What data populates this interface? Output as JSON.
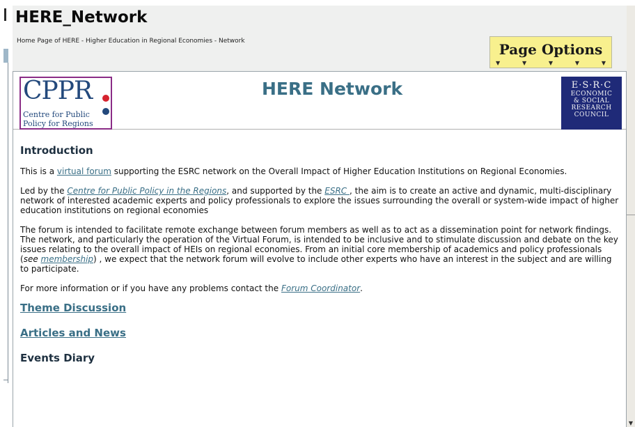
{
  "page": {
    "title": "HERE_Network",
    "breadcrumb": "Home Page of HERE - Higher Education in Regional Economies - Network",
    "page_options_label": "Page Options"
  },
  "banner": {
    "heading": "HERE Network",
    "cppr_logo": {
      "big": "CPPR",
      "line1": "Centre for Public",
      "line2": "Policy for Regions"
    },
    "esrc_logo": {
      "line1": "E·S·R·C",
      "line2": "ECONOMIC",
      "line3": "& SOCIAL",
      "line4": "RESEARCH",
      "line5": "COUNCIL"
    }
  },
  "intro": {
    "heading": "Introduction",
    "p1": {
      "pre": "This is a ",
      "link": "virtual forum",
      "post": " supporting the ESRC network on the Overall Impact of Higher Education Institutions on Regional Economies."
    },
    "p2": {
      "pre": "Led by the ",
      "link1": "Centre for Public Policy in the Regions",
      "mid": ", and supported by the ",
      "link2": "ESRC ",
      "post": ", the aim is to create an active and dynamic, multi-disciplinary network of interested academic experts and policy professionals to explore the issues surrounding the overall or system-wide impact of higher education institutions on regional economies"
    },
    "p3": {
      "pre": "The forum is intended to facilitate remote exchange between forum members as well as to act as a dissemination point for network findings. The network, and particularly the operation of the Virtual Forum, is intended to be inclusive and to stimulate discussion and debate on the key issues relating to the overall impact of HEIs on regional economies. From an initial core membership of academics and policy professionals (",
      "see": "see ",
      "link": "membership",
      "post": ") , we expect that the network forum will evolve to include other experts who have an interest in the subject and are willing to participate."
    },
    "p4": {
      "pre": "For more information or if you have any problems contact the ",
      "link": "Forum Coordinator",
      "post": "."
    }
  },
  "sections": {
    "theme": "Theme Discussion",
    "articles": "Articles and News",
    "events": "Events Diary"
  },
  "colors": {
    "link": "#3a6f86",
    "page_options_bg": "#f8f08e",
    "esrc_bg": "#1f2a78",
    "cppr_border": "#8a2c86"
  }
}
